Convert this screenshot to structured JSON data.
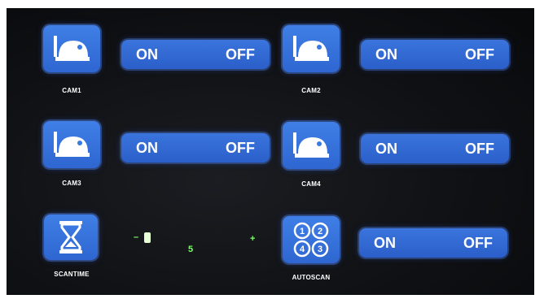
{
  "cameras": [
    {
      "label": "CAM1",
      "on": "ON",
      "off": "OFF"
    },
    {
      "label": "CAM2",
      "on": "ON",
      "off": "OFF"
    },
    {
      "label": "CAM3",
      "on": "ON",
      "off": "OFF"
    },
    {
      "label": "CAM4",
      "on": "ON",
      "off": "OFF"
    }
  ],
  "scantime": {
    "label": "SCANTIME",
    "minus": "–",
    "value": "5",
    "plus": "+",
    "icon": "hourglass-icon"
  },
  "autoscan": {
    "label": "AUTOSCAN",
    "on": "ON",
    "off": "OFF",
    "icon": "quad-cycle-icon",
    "badges": [
      "1",
      "2",
      "3",
      "4"
    ]
  },
  "colors": {
    "accent_blue": "#3a74dc",
    "text": "#ffffff",
    "scan_green": "#7cff6a"
  }
}
